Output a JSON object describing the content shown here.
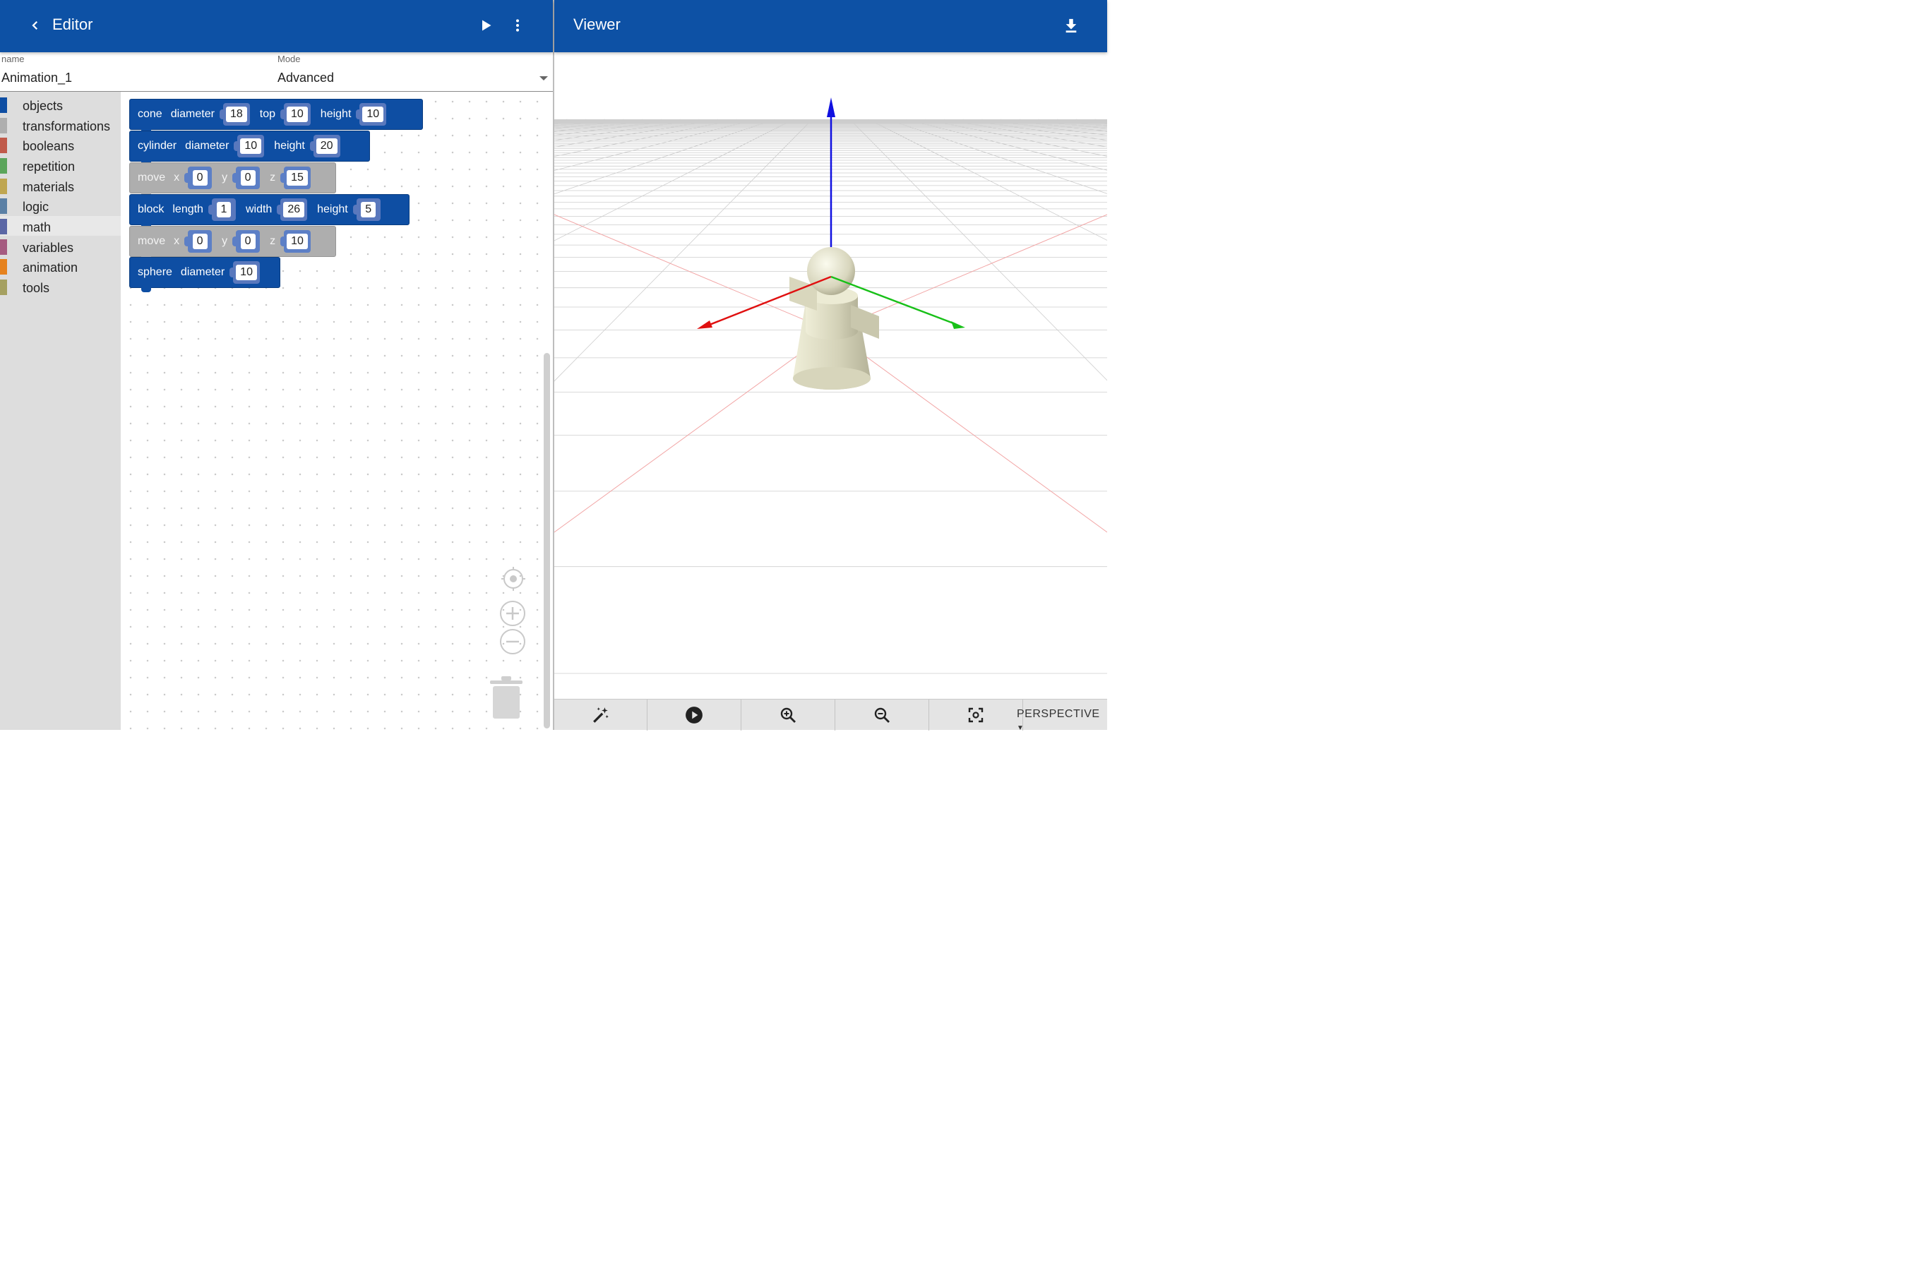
{
  "editor": {
    "title": "Editor",
    "back_icon": "chevron-left-icon",
    "run_icon": "play-icon",
    "menu_icon": "more-vert-icon",
    "name_label": "name",
    "name_value": "Animation_1",
    "mode_label": "Mode",
    "mode_value": "Advanced"
  },
  "viewer": {
    "title": "Viewer",
    "download_icon": "download-icon",
    "axes_colors": {
      "x": "#e01010",
      "y": "#18c018",
      "z": "#1010e0"
    },
    "projection": "PERSPECTIVE"
  },
  "toolbox": {
    "categories": [
      {
        "label": "objects",
        "color": "#0e4ea3"
      },
      {
        "label": "transformations",
        "color": "#aeaeae"
      },
      {
        "label": "booleans",
        "color": "#c05a4a"
      },
      {
        "label": "repetition",
        "color": "#5ba55b"
      },
      {
        "label": "materials",
        "color": "#bfa650"
      },
      {
        "label": "logic",
        "color": "#5b80a5"
      },
      {
        "label": "math",
        "color": "#5b67a5"
      },
      {
        "label": "variables",
        "color": "#a55b80"
      },
      {
        "label": "animation",
        "color": "#e6821e"
      },
      {
        "label": "tools",
        "color": "#a5a060"
      }
    ]
  },
  "blocks": {
    "cone": {
      "name": "cone",
      "p1": "diameter",
      "v1": "18",
      "p2": "top",
      "v2": "10",
      "p3": "height",
      "v3": "10"
    },
    "cylinder": {
      "name": "cylinder",
      "p1": "diameter",
      "v1": "10",
      "p2": "height",
      "v2": "20"
    },
    "move1": {
      "name": "move",
      "p1": "x",
      "v1": "0",
      "p2": "y",
      "v2": "0",
      "p3": "z",
      "v3": "15"
    },
    "block": {
      "name": "block",
      "p1": "length",
      "v1": "1",
      "p2": "width",
      "v2": "26",
      "p3": "height",
      "v3": "5"
    },
    "move2": {
      "name": "move",
      "p1": "x",
      "v1": "0",
      "p2": "y",
      "v2": "0",
      "p3": "z",
      "v3": "10"
    },
    "sphere": {
      "name": "sphere",
      "p1": "diameter",
      "v1": "10"
    }
  },
  "workspace_controls": [
    "recenter-icon",
    "zoom-in-icon",
    "zoom-out-icon",
    "trash-icon"
  ],
  "viewer_toolbar": [
    "magic-wand-icon",
    "play-circle-icon",
    "zoom-in-icon",
    "zoom-out-icon",
    "focus-icon"
  ]
}
